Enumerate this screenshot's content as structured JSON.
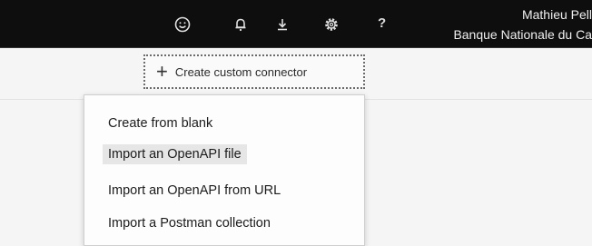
{
  "topbar": {
    "icons": [
      "smiley-icon",
      "bell-icon",
      "download-icon",
      "gear-icon"
    ],
    "help": "?",
    "user": {
      "name": "Mathieu Pell",
      "org": "Banque Nationale du Ca"
    }
  },
  "create_button": {
    "icon": "+",
    "label": "Create custom connector"
  },
  "menu": {
    "items": [
      {
        "label": "Create from blank"
      },
      {
        "label": "Import an OpenAPI file"
      },
      {
        "label": "Import an OpenAPI from URL"
      },
      {
        "label": "Import a Postman collection"
      }
    ]
  }
}
